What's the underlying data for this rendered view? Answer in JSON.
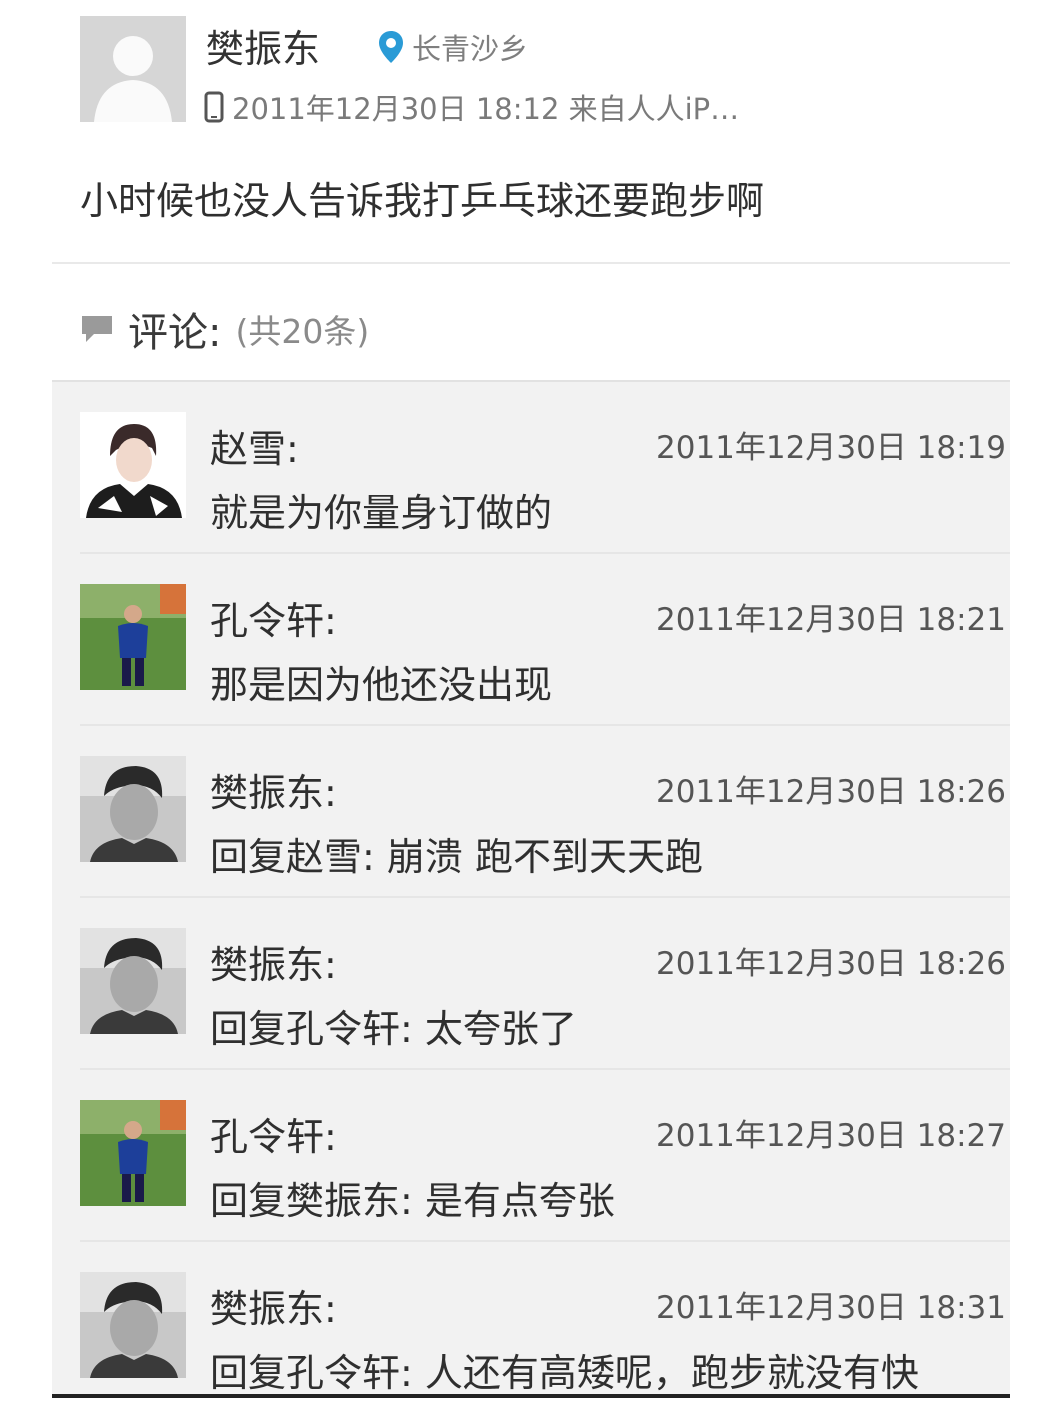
{
  "post": {
    "author": "樊振东",
    "location": "长青沙乡",
    "meta": "2011年12月30日 18:12 来自人人iP…",
    "content": "小时候也没人告诉我打乒乓球还要跑步啊"
  },
  "comments_header": {
    "title": "评论:",
    "count": "(共20条)"
  },
  "comments": [
    {
      "name": "赵雪:",
      "time": "2011年12月30日 18:19",
      "text": "就是为你量身订做的",
      "avatar": "avatar-zhao-xue"
    },
    {
      "name": "孔令轩:",
      "time": "2011年12月30日 18:21",
      "text": "那是因为他还没出现",
      "avatar": "avatar-kong-lingxuan"
    },
    {
      "name": "樊振东:",
      "time": "2011年12月30日 18:26",
      "text": "回复赵雪: 崩溃 跑不到天天跑",
      "avatar": "avatar-fan-zhendong"
    },
    {
      "name": "樊振东:",
      "time": "2011年12月30日 18:26",
      "text": "回复孔令轩: 太夸张了",
      "avatar": "avatar-fan-zhendong"
    },
    {
      "name": "孔令轩:",
      "time": "2011年12月30日 18:27",
      "text": "回复樊振东: 是有点夸张",
      "avatar": "avatar-kong-lingxuan"
    },
    {
      "name": "樊振东:",
      "time": "2011年12月30日 18:31",
      "text": "回复孔令轩: 人还有高矮呢，跑步就没有快",
      "avatar": "avatar-fan-zhendong"
    }
  ],
  "icons": {
    "location": "location-pin-icon",
    "device": "phone-icon",
    "comment": "comment-bubble-icon"
  },
  "colors": {
    "accent": "#2a9bd6",
    "comment_bg": "#f2f2f2"
  }
}
